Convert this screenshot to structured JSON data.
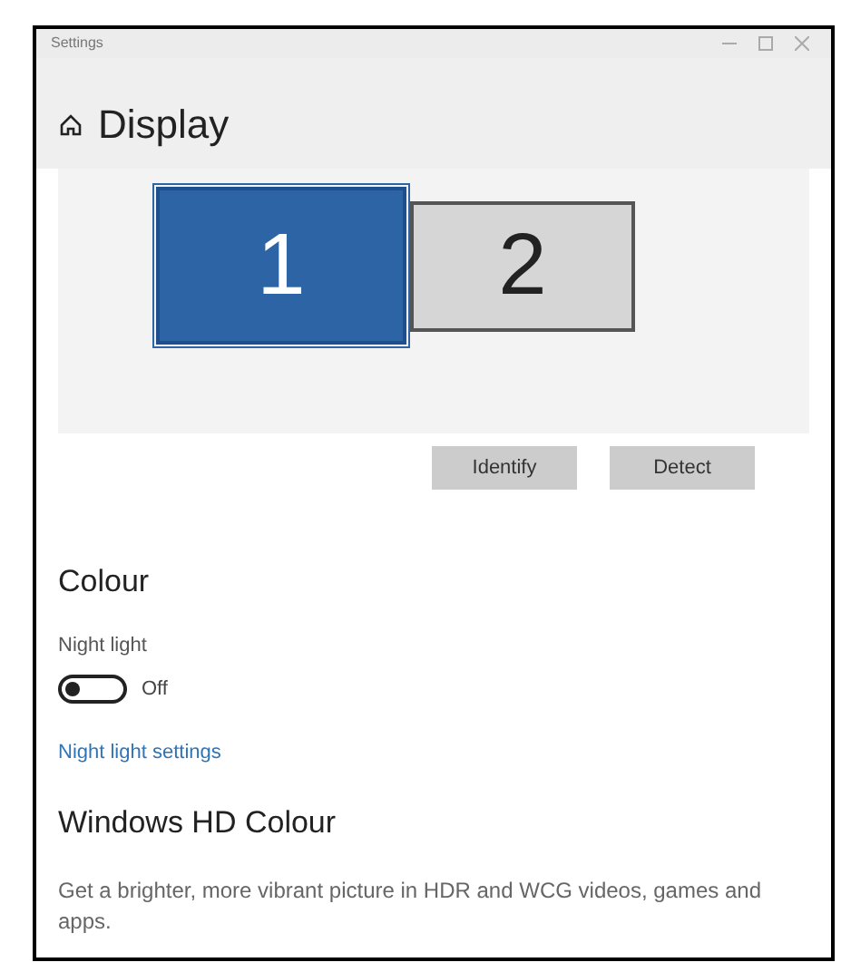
{
  "window": {
    "title": "Settings"
  },
  "page": {
    "title": "Display"
  },
  "monitors": [
    {
      "label": "1",
      "selected": true
    },
    {
      "label": "2",
      "selected": false
    }
  ],
  "buttons": [
    "Identify",
    "Detect"
  ],
  "colour": {
    "heading": "Colour",
    "night_light": {
      "label": "Night light",
      "on": false,
      "state_text": "Off"
    },
    "link": "Night light settings"
  },
  "hd_colour": {
    "heading": "Windows HD Colour",
    "description": "Get a brighter, more vibrant picture in HDR and WCG videos, games and apps."
  }
}
